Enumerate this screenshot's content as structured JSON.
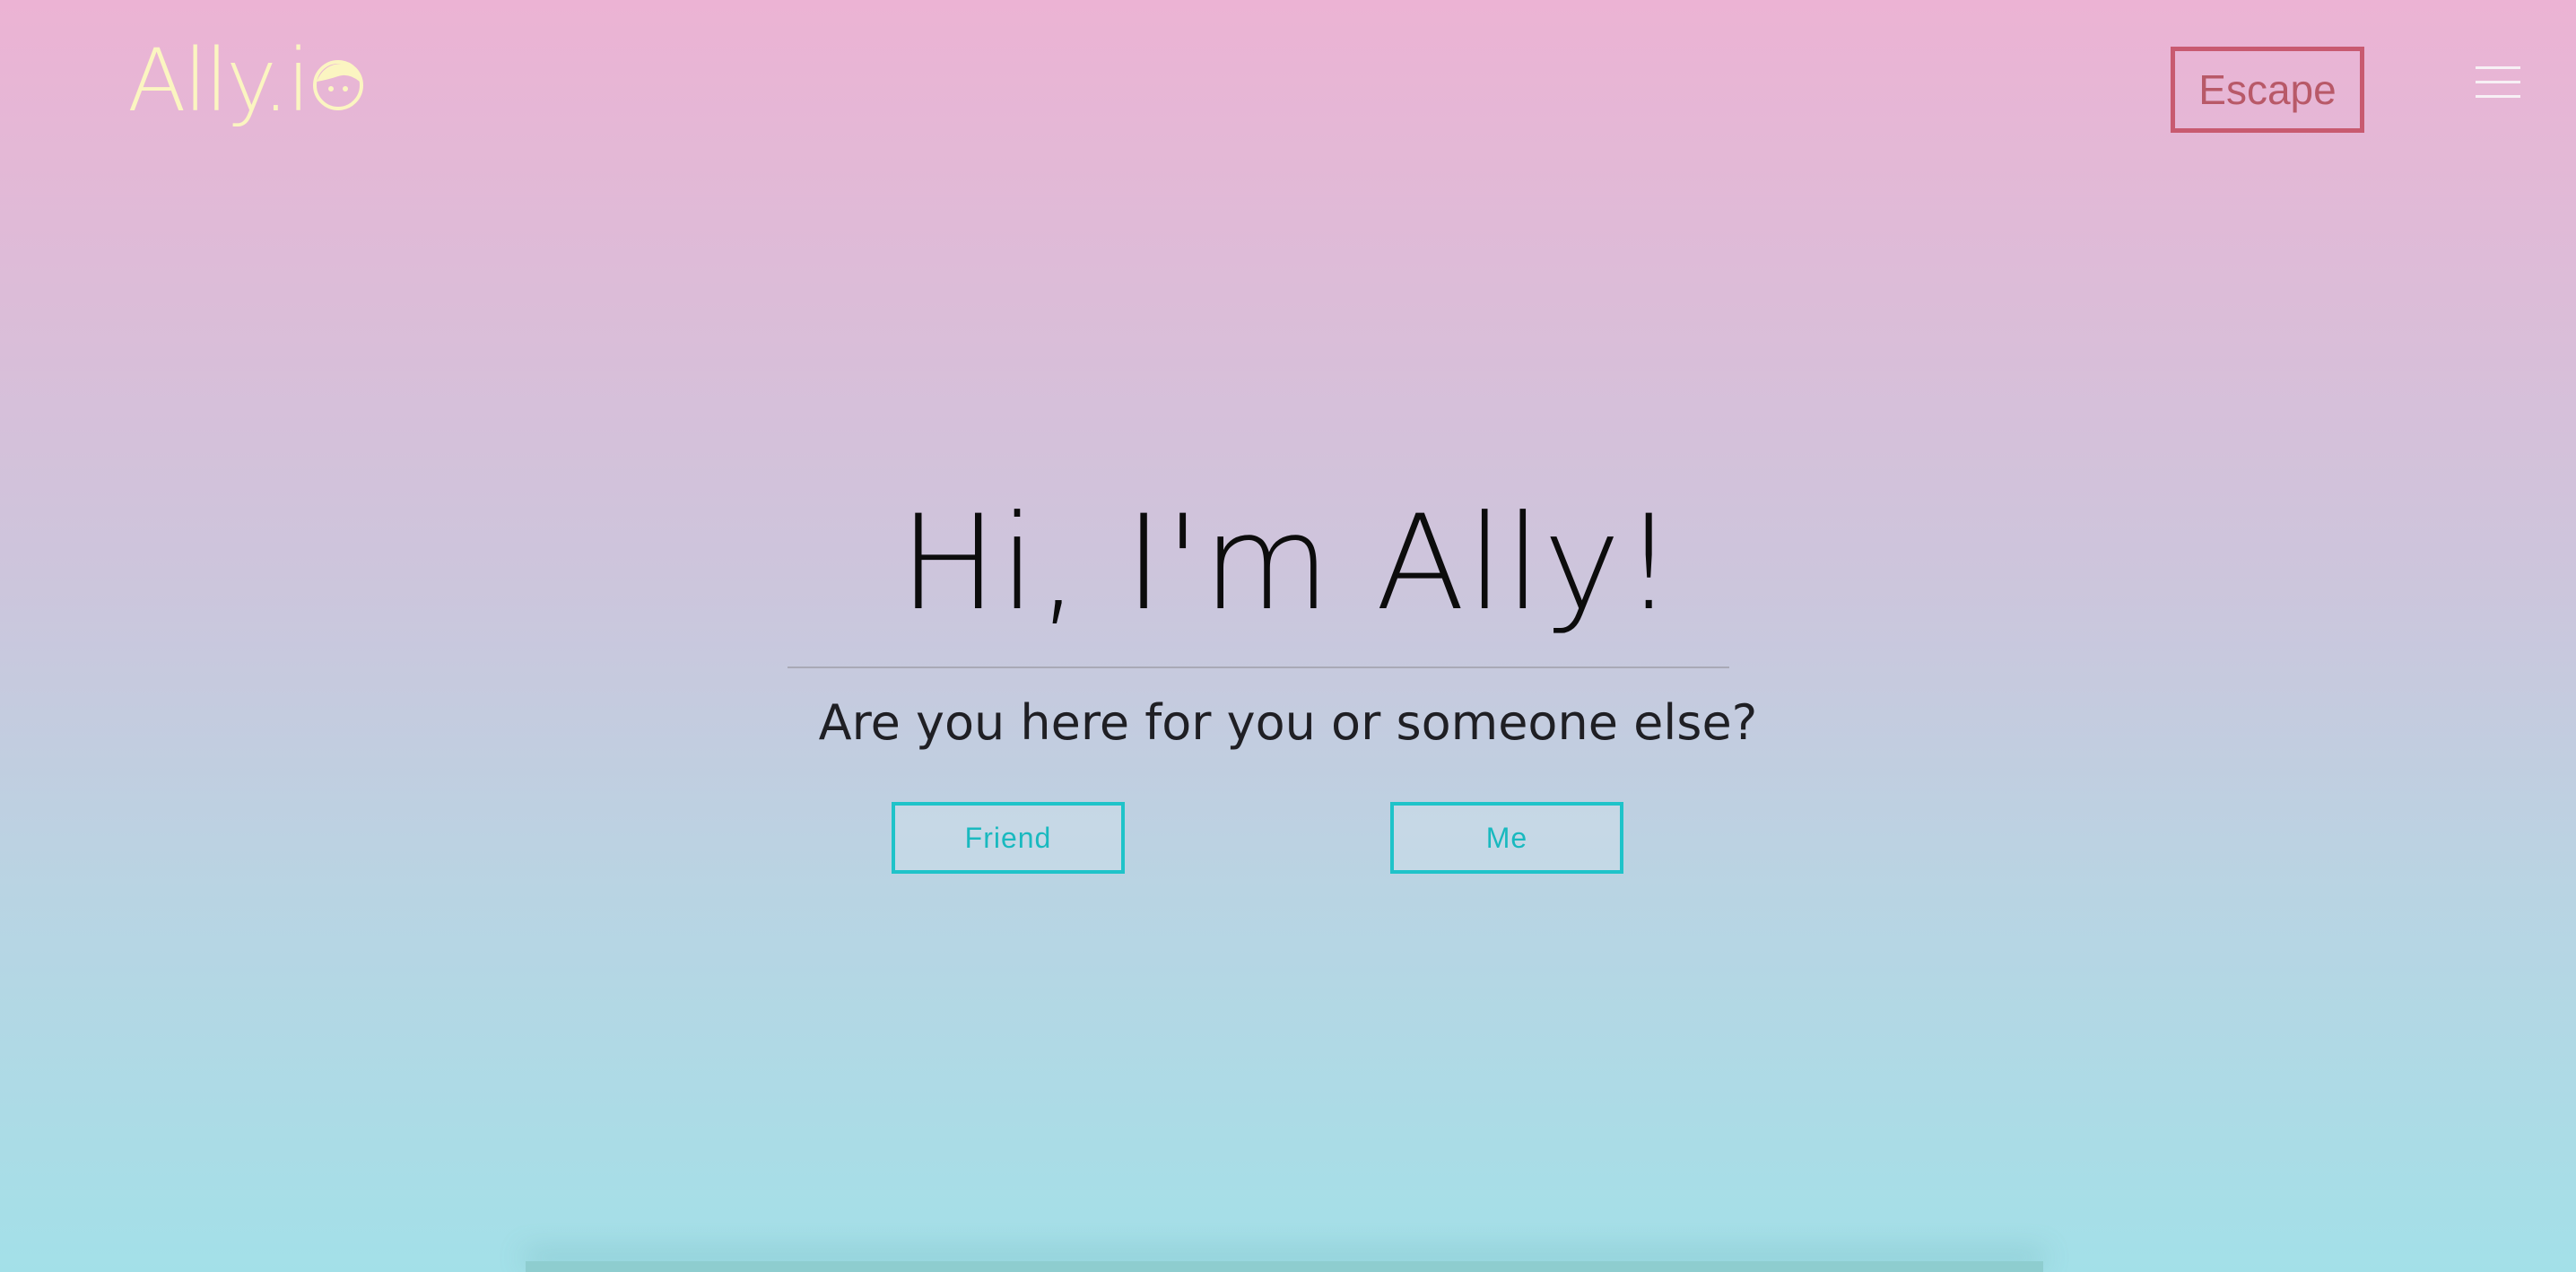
{
  "header": {
    "logo_text": "Ally.i",
    "logo_icon": "face-icon",
    "escape_label": "Escape",
    "menu_icon": "hamburger-menu-icon"
  },
  "hero": {
    "title": "Hi, I'm Ally!",
    "question": "Are you here for you or someone else?",
    "friend_label": "Friend",
    "me_label": "Me"
  },
  "colors": {
    "gradient_top": "#ecb3d4",
    "gradient_bottom": "#a3e0e8",
    "logo": "#fbf5c1",
    "escape": "#c85a70",
    "accent": "#1fc3c9"
  }
}
